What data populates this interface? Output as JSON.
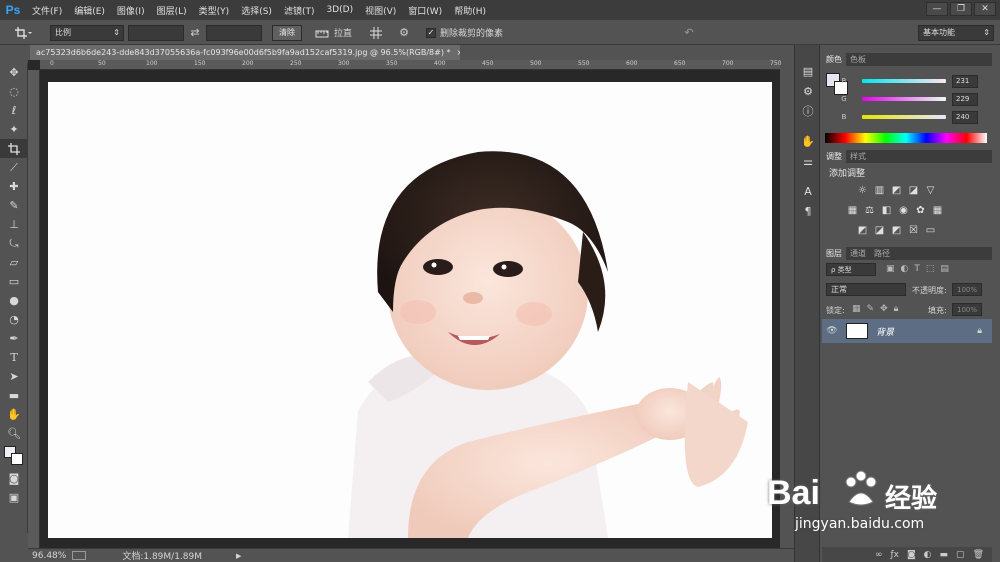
{
  "app": {
    "logo": "Ps"
  },
  "menu": [
    "文件(F)",
    "编辑(E)",
    "图像(I)",
    "图层(L)",
    "类型(Y)",
    "选择(S)",
    "滤镜(T)",
    "3D(D)",
    "视图(V)",
    "窗口(W)",
    "帮助(H)"
  ],
  "window_controls": {
    "minimize": "—",
    "restore": "❐",
    "close": "✕"
  },
  "options": {
    "ratio_select": "比例",
    "clear_button": "清除",
    "straighten_label": "拉直",
    "delete_cropped_label": "删除裁剪的像素",
    "delete_cropped_checked": true,
    "workspace": "基本功能"
  },
  "document": {
    "tab_title": "ac75323d6b6de243-dde843d37055636a-fc093f96e00d6f5b9fa9ad152caf5319.jpg @ 96.5%(RGB/8#) *",
    "tab_close": "×",
    "ruler_ticks": [
      "0",
      "50",
      "100",
      "150",
      "200",
      "250",
      "300",
      "350",
      "400",
      "450",
      "500",
      "550",
      "600",
      "650",
      "700",
      "750"
    ]
  },
  "status": {
    "zoom": "96.48%",
    "doc_info": "文档:1.89M/1.89M",
    "arrow": "▶"
  },
  "color_panel": {
    "tabs": [
      "颜色",
      "色板"
    ],
    "channels": [
      {
        "label": "R",
        "value": "231"
      },
      {
        "label": "G",
        "value": "229"
      },
      {
        "label": "B",
        "value": "240"
      }
    ]
  },
  "adjustments_panel": {
    "tabs": [
      "调整",
      "样式"
    ],
    "title": "添加调整"
  },
  "layers_panel": {
    "tabs": [
      "图层",
      "通道",
      "路径"
    ],
    "filter_type": "ρ 类型",
    "blend_mode": "正常",
    "opacity_label": "不透明度:",
    "opacity_value": "100%",
    "lock_label": "锁定:",
    "fill_label": "填充:",
    "fill_value": "100%",
    "layer_name": "背景"
  },
  "watermark": {
    "brand": "Bai",
    "brand_cn": "经验",
    "url": "jingyan.baidu.com"
  },
  "colors": {
    "accent": "#31a8ff",
    "selected_layer": "#5d6d84",
    "green": "#12b34b"
  }
}
